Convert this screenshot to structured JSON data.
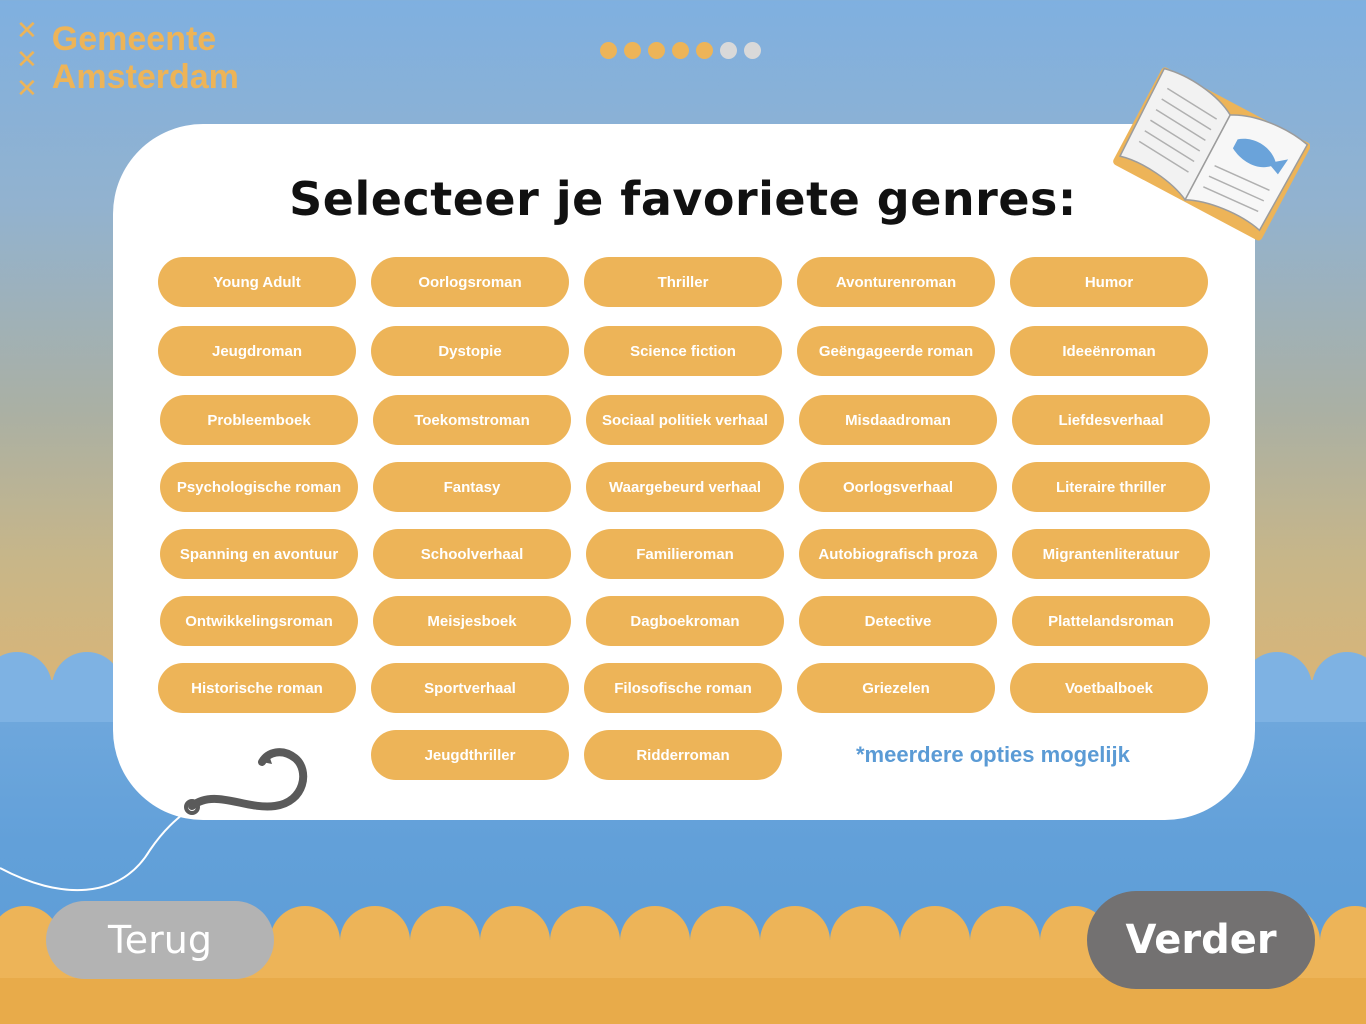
{
  "header": {
    "logo_line1": "Gemeente",
    "logo_line2": "Amsterdam",
    "progress": {
      "total": 7,
      "completed": 5
    }
  },
  "main": {
    "title": "Selecteer je favoriete genres:",
    "genres": [
      "Young Adult",
      "Oorlogsroman",
      "Thriller",
      "Avonturenroman",
      "Humor",
      "Jeugdroman",
      "Dystopie",
      "Science fiction",
      "Geëngageerde roman",
      "Ideeënroman",
      "Probleemboek",
      "Toekomstroman",
      "Sociaal politiek verhaal",
      "Misdaadroman",
      "Liefdesverhaal",
      "Psychologische roman",
      "Fantasy",
      "Waargebeurd verhaal",
      "Oorlogsverhaal",
      "Literaire thriller",
      "Spanning en avontuur",
      "Schoolverhaal",
      "Familieroman",
      "Autobiografisch proza",
      "Migrantenliteratuur",
      "Ontwikkelingsroman",
      "Meisjesboek",
      "Dagboekroman",
      "Detective",
      "Plattelandsroman",
      "Historische roman",
      "Sportverhaal",
      "Filosofische roman",
      "Griezelen",
      "Voetbalboek",
      "Jeugdthriller",
      "Ridderroman"
    ],
    "note": "*meerdere opties mogelijk"
  },
  "footer": {
    "back_label": "Terug",
    "next_label": "Verder"
  },
  "colors": {
    "accent": "#edb458",
    "note": "#5b9bd5",
    "back_button": "#b3b3b3",
    "next_button": "#737171"
  },
  "icons": {
    "logo": "andreas-crosses-icon",
    "book": "open-book-icon",
    "hook": "fishing-hook-icon"
  }
}
